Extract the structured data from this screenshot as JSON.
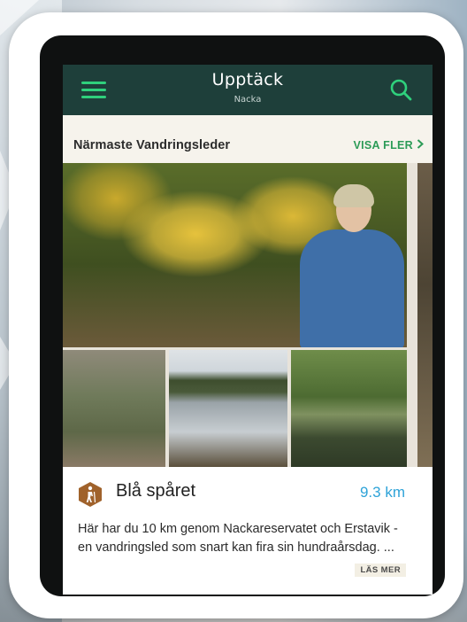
{
  "app": {
    "title": "Upptäck",
    "subtitle": "Nacka"
  },
  "icons": {
    "menu": "hamburger-menu-icon",
    "search": "search-icon",
    "more_chevron": "chevron-right-icon",
    "hiking": "hiking-person-icon"
  },
  "section": {
    "title": "Närmaste Vandringsleder",
    "more_label": "VISA FLER",
    "more_chevron": "›"
  },
  "trail": {
    "name": "Blå spåret",
    "distance": "9.3 km",
    "description": "Här har du 10 km genom Nackareservatet och Erstavik - en vandringsled som snart kan fira sin hundraårsdag. ...",
    "read_more_label": "LÄS MER"
  },
  "colors": {
    "app_bar": "#1e3f3a",
    "accent_green": "#2fd07c",
    "visa_fler_green": "#2c9b57",
    "distance_blue": "#2ea3d8",
    "badge_brown": "#a0622b",
    "section_bg": "#f6f3ec"
  }
}
